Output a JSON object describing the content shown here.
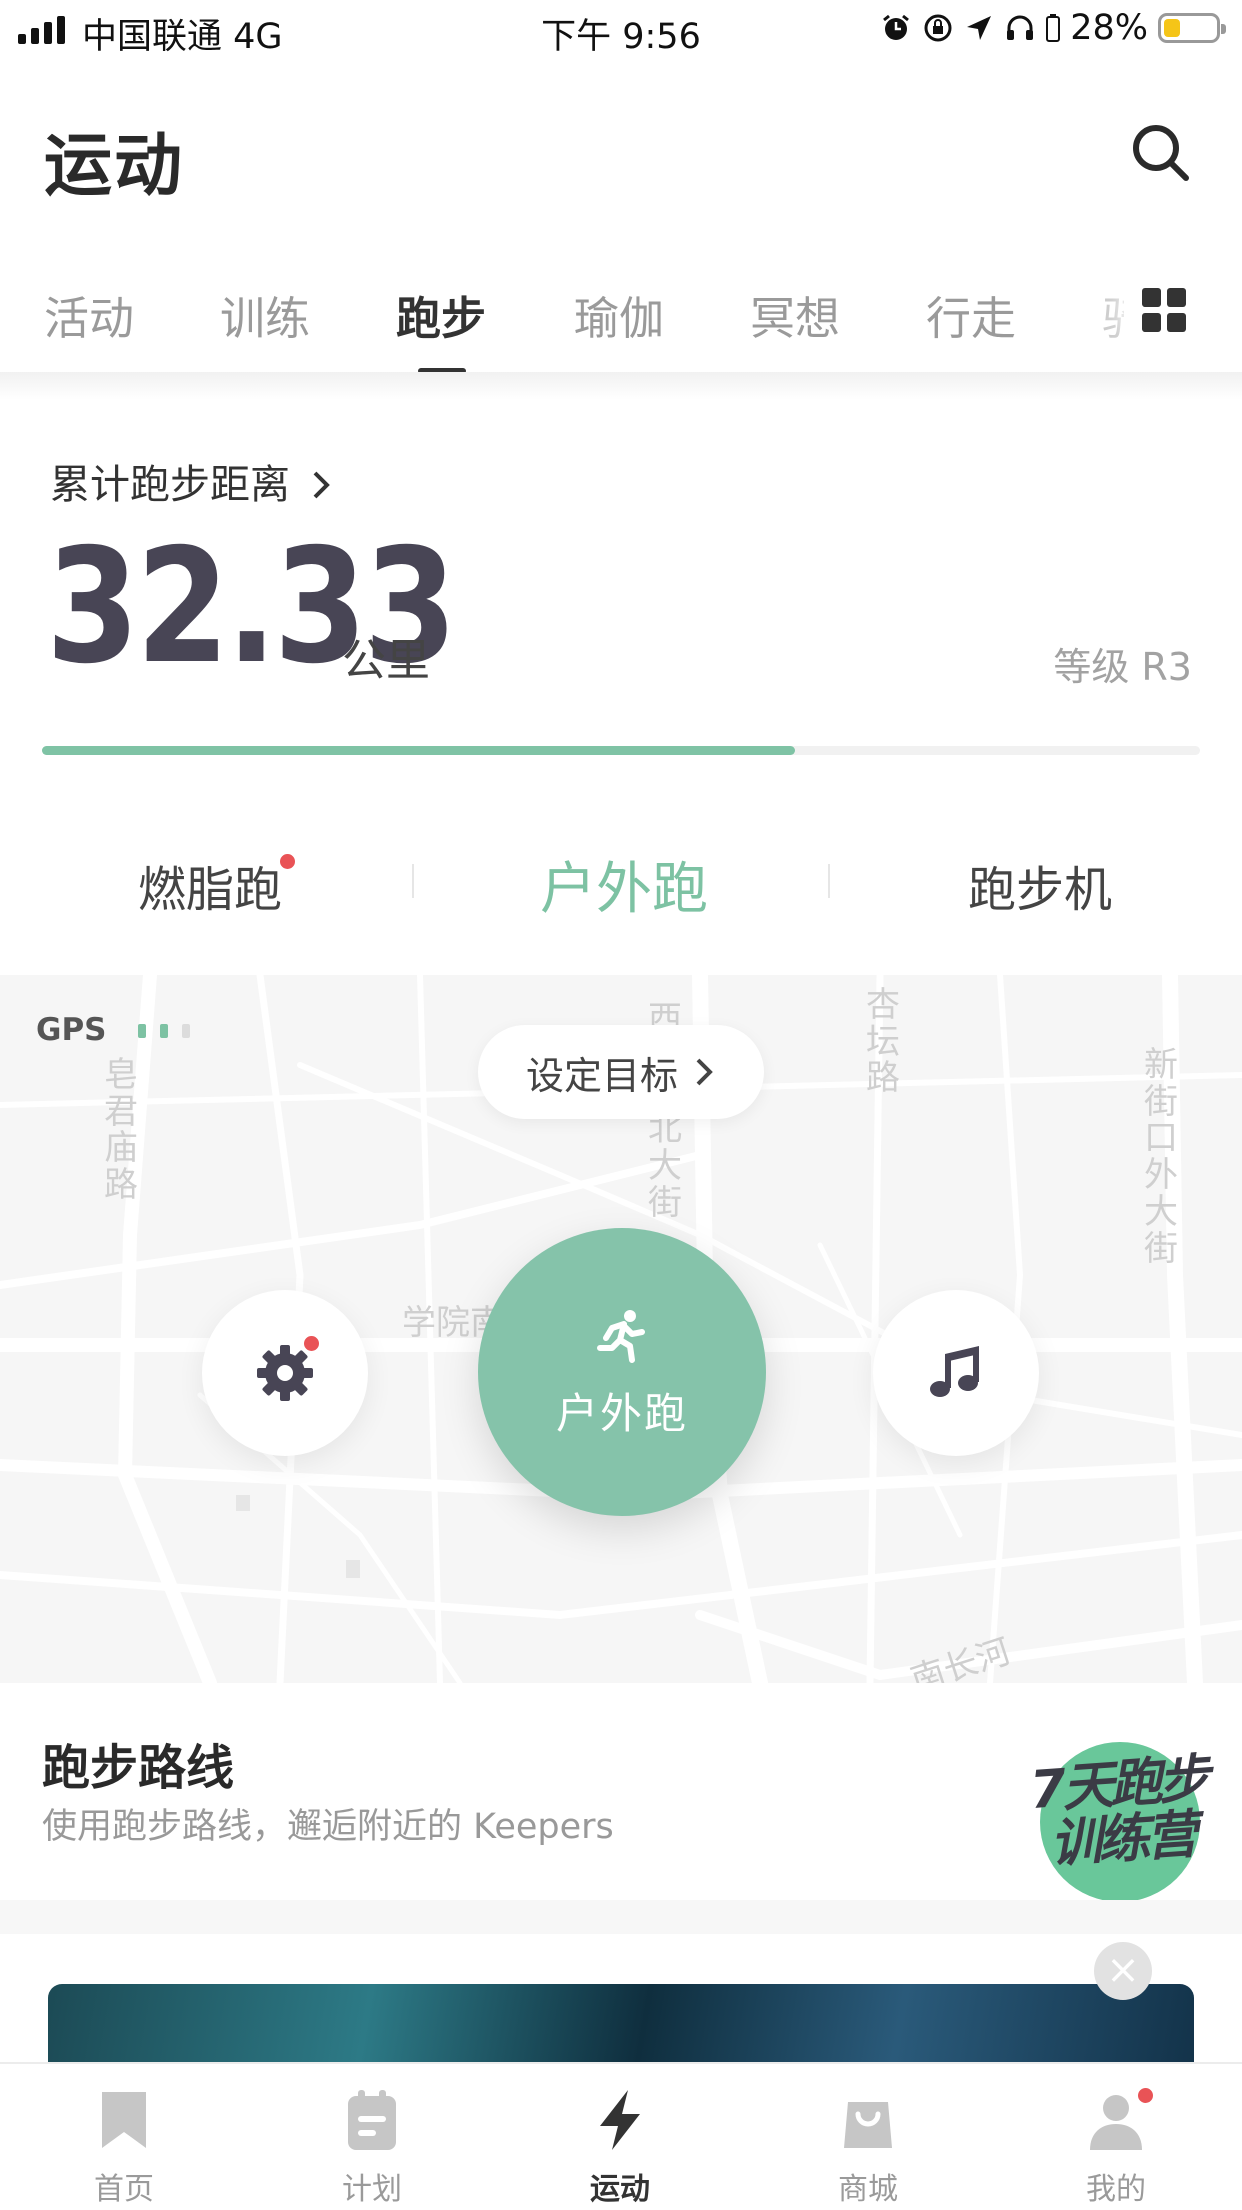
{
  "status_bar": {
    "carrier": "中国联通 4G",
    "time": "下午 9:56",
    "battery": "28%"
  },
  "header": {
    "title": "运动",
    "search_icon": "search-icon"
  },
  "category_tabs": [
    {
      "label": "活动"
    },
    {
      "label": "训练"
    },
    {
      "label": "跑步",
      "active": true
    },
    {
      "label": "瑜伽"
    },
    {
      "label": "冥想"
    },
    {
      "label": "行走"
    },
    {
      "label": "骑"
    }
  ],
  "summary": {
    "label": "累计跑步距离",
    "distance": "32.33",
    "unit": "公里",
    "level": "等级 R3",
    "progress": 0.65
  },
  "modes": [
    {
      "label": "燃脂跑",
      "badge": true
    },
    {
      "label": "户外跑",
      "active": true
    },
    {
      "label": "跑步机"
    }
  ],
  "map": {
    "gps_label": "GPS",
    "goal_button": "设定目标",
    "start_button": "户外跑",
    "street_labels": [
      "皂君庙路",
      "西直门北大街",
      "杏坛路",
      "新街口外大街",
      "学院南路",
      "南长河"
    ]
  },
  "route": {
    "title": "跑步路线",
    "subtitle": "使用跑步路线，邂逅附近的 Keepers",
    "promo_lines": [
      "7天跑步",
      "训练营"
    ]
  },
  "tab_bar": [
    {
      "label": "首页",
      "icon": "bookmark-icon"
    },
    {
      "label": "计划",
      "icon": "clipboard-icon"
    },
    {
      "label": "运动",
      "icon": "lightning-icon",
      "active": true
    },
    {
      "label": "商城",
      "icon": "shopping-bag-icon"
    },
    {
      "label": "我的",
      "icon": "person-icon",
      "badge": true
    }
  ],
  "colors": {
    "accent": "#7dc2a3",
    "start_button": "#85c3aa",
    "badge": "#e95356",
    "title_text": "#2a2a2a"
  }
}
